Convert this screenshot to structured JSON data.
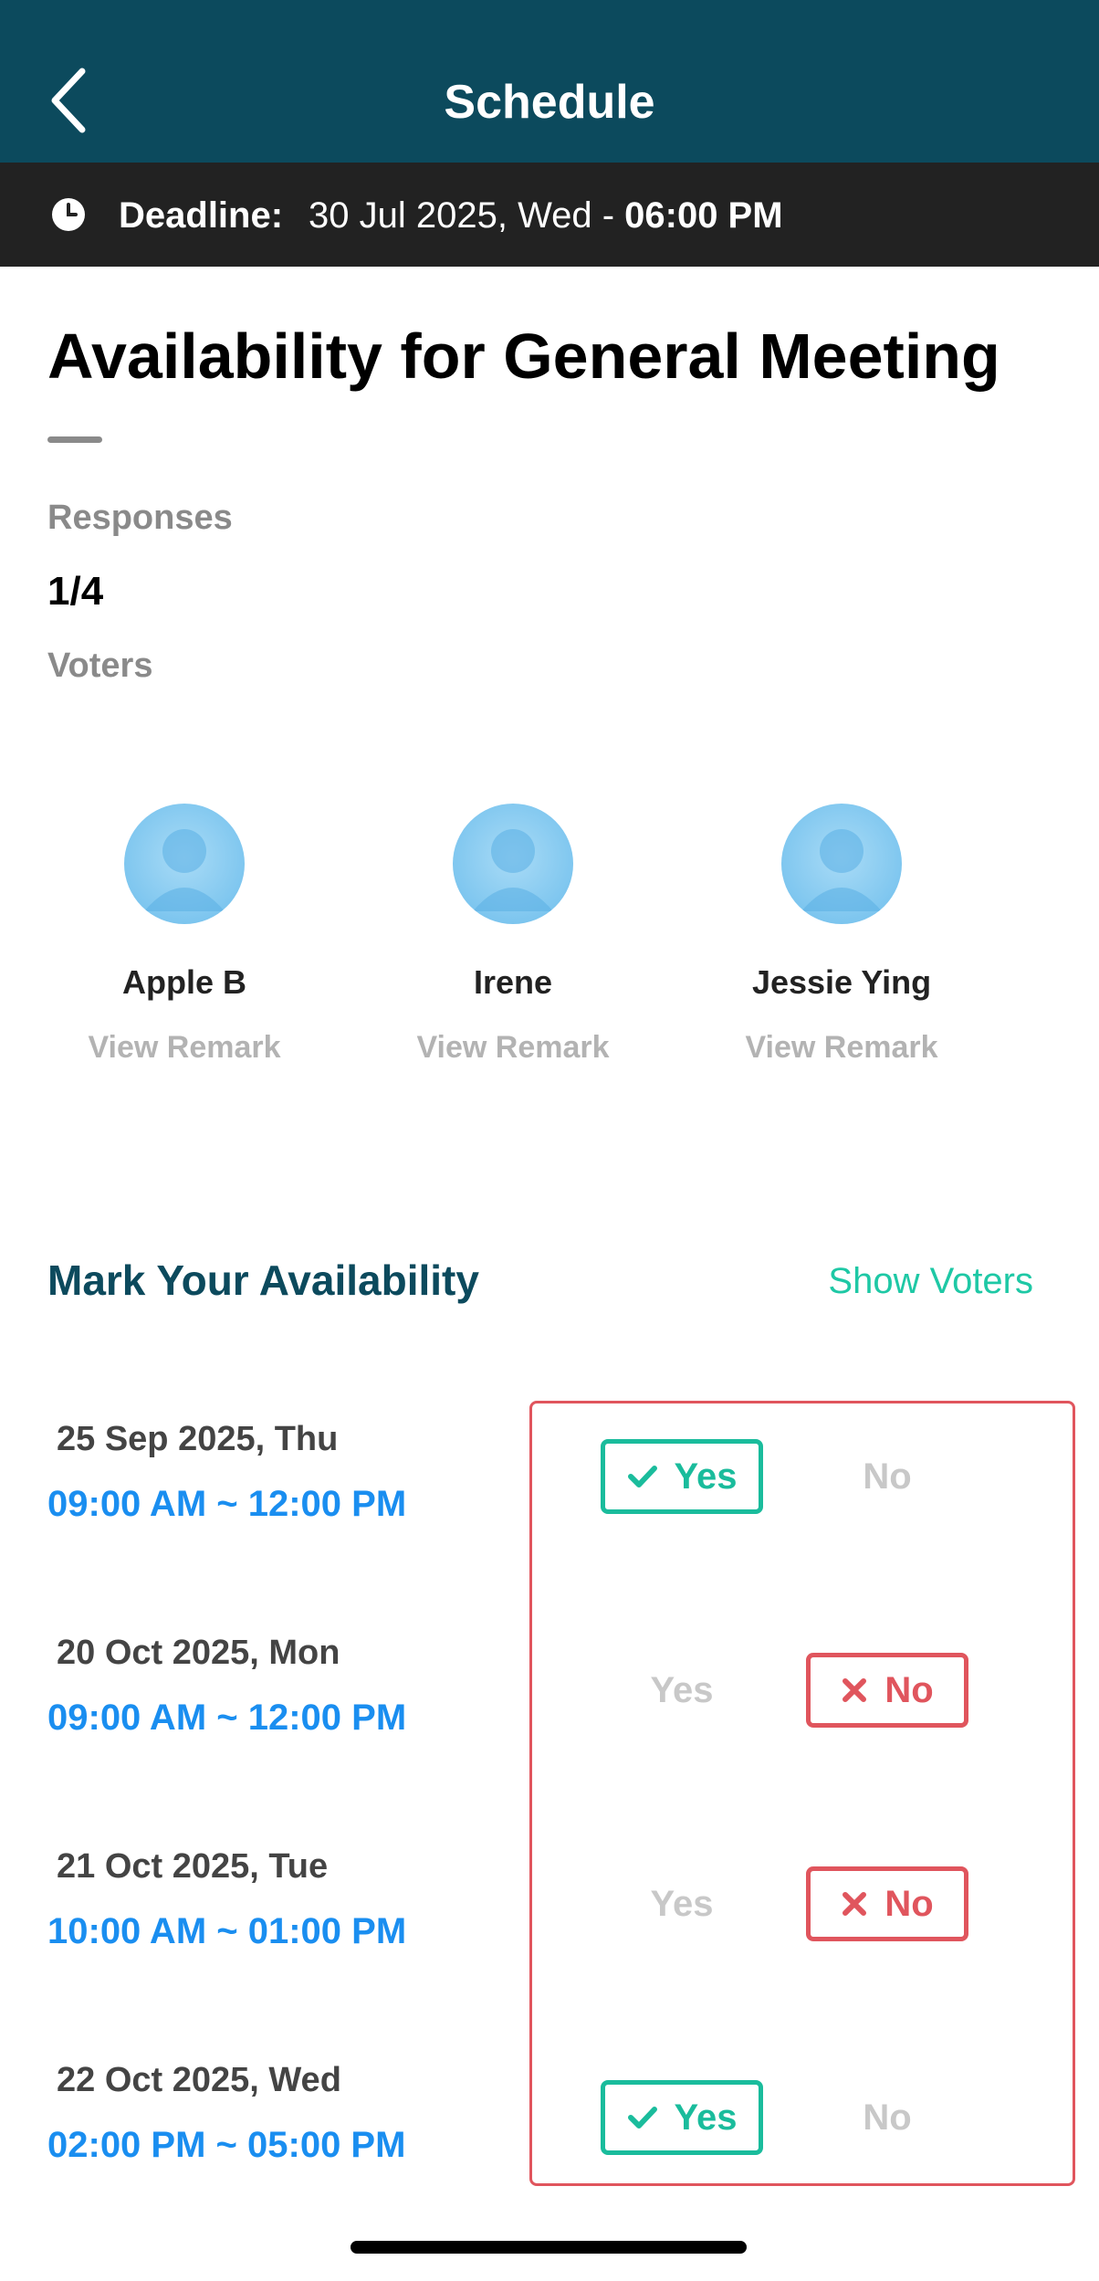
{
  "header": {
    "title": "Schedule",
    "background": "#0c4a5d"
  },
  "deadline": {
    "label": "Deadline:",
    "date": "30 Jul 2025, Wed - ",
    "time": "06:00 PM"
  },
  "poll": {
    "title": "Availability for General Meeting",
    "responses_label": "Responses",
    "responses_count": "1/4",
    "voters_label": "Voters"
  },
  "voters": [
    {
      "name": "Apple B",
      "remark": "View Remark"
    },
    {
      "name": "Irene",
      "remark": "View Remark"
    },
    {
      "name": "Jessie Ying",
      "remark": "View Remark"
    }
  ],
  "availability": {
    "title": "Mark Your Availability",
    "show_voters": "Show Voters",
    "yes_label": "Yes",
    "no_label": "No",
    "slots": [
      {
        "date": "25 Sep 2025, Thu",
        "time": "09:00 AM ~ 12:00 PM",
        "selection": "yes"
      },
      {
        "date": "20 Oct 2025, Mon",
        "time": "09:00 AM ~ 12:00 PM",
        "selection": "no"
      },
      {
        "date": "21 Oct 2025, Tue",
        "time": "10:00 AM ~ 01:00 PM",
        "selection": "no"
      },
      {
        "date": "22 Oct 2025, Wed",
        "time": "02:00 PM ~ 05:00 PM",
        "selection": "yes"
      }
    ]
  },
  "colors": {
    "accent": "#1abc9c",
    "negative": "#e0555d",
    "time": "#1a8ef0"
  }
}
